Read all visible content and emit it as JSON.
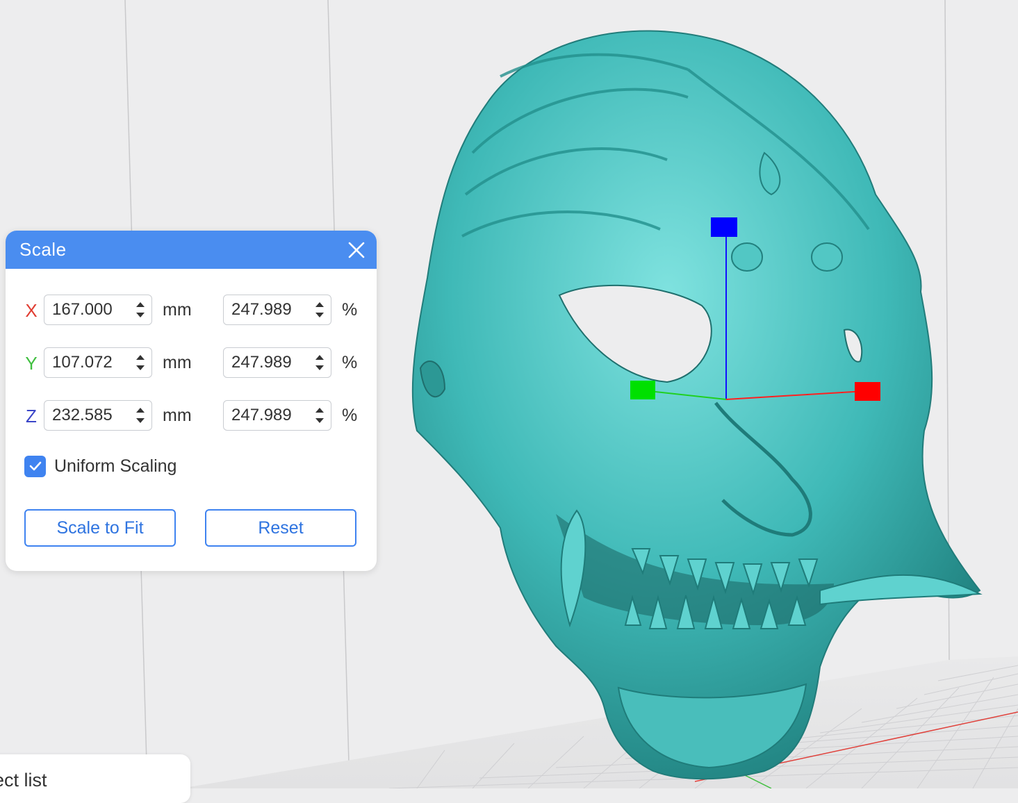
{
  "scale_panel": {
    "title": "Scale",
    "rows": [
      {
        "axis": "X",
        "axis_color": "#e03c31",
        "mm": "167.000",
        "mm_unit": "mm",
        "percent": "247.989",
        "percent_unit": "%"
      },
      {
        "axis": "Y",
        "axis_color": "#3fbf3f",
        "mm": "107.072",
        "mm_unit": "mm",
        "percent": "247.989",
        "percent_unit": "%"
      },
      {
        "axis": "Z",
        "axis_color": "#3b46c8",
        "mm": "232.585",
        "mm_unit": "mm",
        "percent": "247.989",
        "percent_unit": "%"
      }
    ],
    "uniform_scaling": {
      "label": "Uniform Scaling",
      "checked": true
    },
    "scale_to_fit_label": "Scale to Fit",
    "reset_label": "Reset"
  },
  "object_list": {
    "label": "ect list"
  },
  "viewport": {
    "model_color": "#3fb9b7",
    "gizmo": {
      "x_handle_color": "#ff0000",
      "y_handle_color": "#00e000",
      "z_handle_color": "#0000ff"
    }
  },
  "icons": {
    "close": "close-icon",
    "check": "checkmark-icon",
    "spin_up": "chevron-up-icon",
    "spin_down": "chevron-down-icon"
  }
}
